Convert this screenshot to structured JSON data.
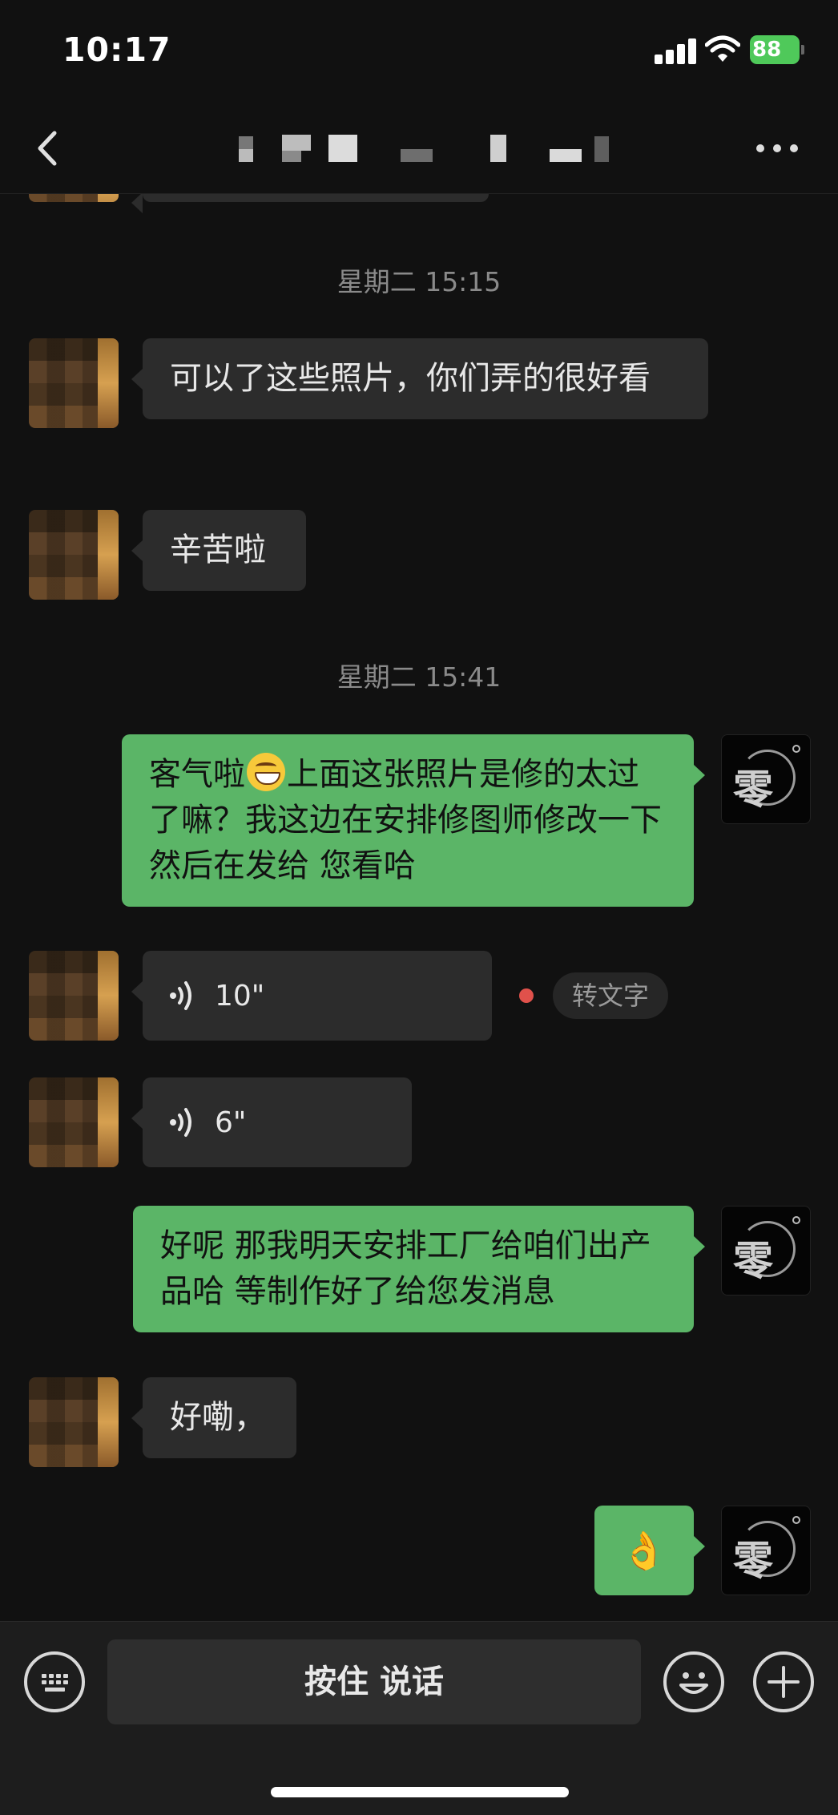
{
  "status": {
    "time": "10:17",
    "battery": "88"
  },
  "header": {
    "title": ""
  },
  "chat": {
    "timestamps": [
      "星期二 15:15",
      "星期二 15:41"
    ],
    "messages": [
      {
        "side": "in",
        "type": "text",
        "text": "可以了这些照片，你们弄的很好看"
      },
      {
        "side": "in",
        "type": "text",
        "text": "辛苦啦"
      },
      {
        "side": "out",
        "type": "text",
        "text_before": "客气啦",
        "text_after": "上面这张照片是修的太过了嘛？我这边在安排修图师修改一下  然后在发给 您看哈"
      },
      {
        "side": "in",
        "type": "voice",
        "duration": "10\"",
        "unread": true,
        "action": "转文字"
      },
      {
        "side": "in",
        "type": "voice",
        "duration": "6\""
      },
      {
        "side": "out",
        "type": "text",
        "text": "好呢 那我明天安排工厂给咱们出产品哈  等制作好了给您发消息"
      },
      {
        "side": "in",
        "type": "text",
        "text": "好嘞，"
      },
      {
        "side": "out",
        "type": "emoji",
        "text": "👌"
      }
    ]
  },
  "inputbar": {
    "hold_label": "按住 说话"
  },
  "icons": {
    "back": "chevron-left-icon",
    "more": "more-dots-icon",
    "keyboard": "keyboard-icon",
    "emoji": "smiley-icon",
    "add": "plus-icon",
    "voice": "voice-wave-icon"
  },
  "colors": {
    "outgoing": "#5bb567",
    "incoming": "#2c2c2c",
    "unread": "#e0514b",
    "battery": "#4fc95a"
  }
}
